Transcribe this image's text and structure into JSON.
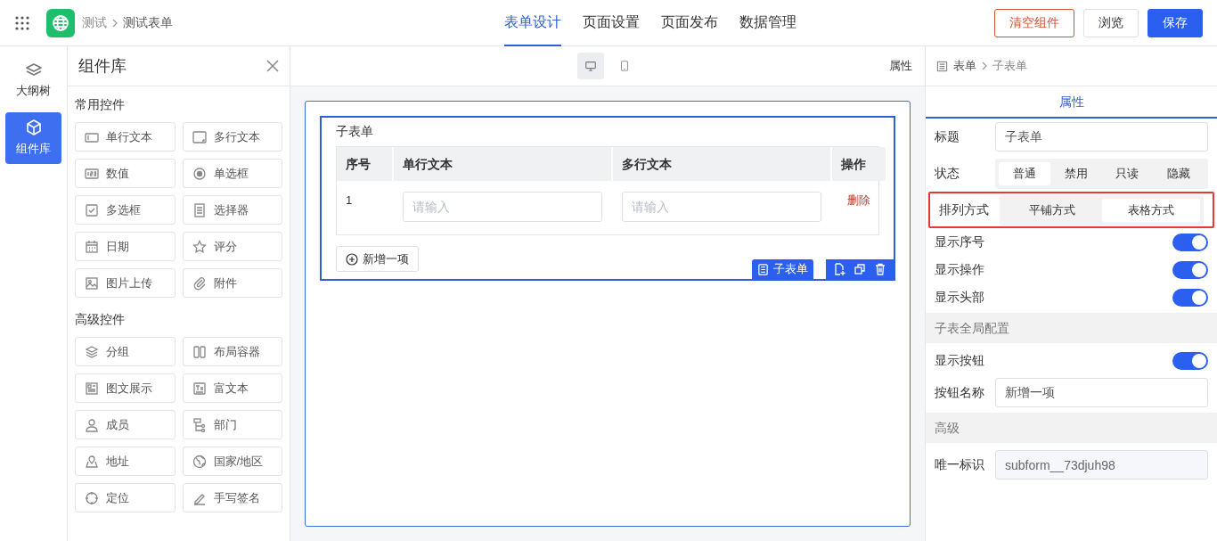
{
  "header": {
    "breadcrumb": [
      "测试",
      "测试表单"
    ],
    "tabs": [
      {
        "label": "表单设计",
        "selected": true
      },
      {
        "label": "页面设置",
        "selected": false
      },
      {
        "label": "页面发布",
        "selected": false
      },
      {
        "label": "数据管理",
        "selected": false
      }
    ],
    "buttons": [
      {
        "label": "清空组件",
        "kind": "danger"
      },
      {
        "label": "浏览",
        "kind": "default"
      },
      {
        "label": "保存",
        "kind": "primary"
      }
    ]
  },
  "rail": [
    {
      "label": "大纲树",
      "selected": false
    },
    {
      "label": "组件库",
      "selected": true
    }
  ],
  "library": {
    "title": "组件库",
    "sections": [
      {
        "title": "常用控件",
        "items": [
          "单行文本",
          "多行文本",
          "数值",
          "单选框",
          "多选框",
          "选择器",
          "日期",
          "评分",
          "图片上传",
          "附件"
        ]
      },
      {
        "title": "高级控件",
        "items": [
          "分组",
          "布局容器",
          "图文展示",
          "富文本",
          "成员",
          "部门",
          "地址",
          "国家/地区",
          "定位",
          "手写签名"
        ]
      }
    ]
  },
  "canvas": {
    "devices": [
      {
        "selected": true
      },
      {
        "selected": false
      }
    ],
    "panel_label": "属性",
    "subform": {
      "title": "子表单",
      "columns": [
        "序号",
        "单行文本",
        "多行文本",
        "操作"
      ],
      "rows": [
        {
          "index": "1",
          "placeholders": [
            "请输入",
            "请输入"
          ],
          "action": "删除"
        }
      ],
      "add_button": "新增一项",
      "tag": "子表单"
    }
  },
  "properties": {
    "breadcrumb": [
      "表单",
      "子表单"
    ],
    "tab": {
      "label": "属性",
      "selected": true
    },
    "rows": [
      {
        "kind": "input",
        "label": "标题",
        "value": "子表单"
      },
      {
        "kind": "segmented",
        "label": "状态",
        "options": [
          {
            "label": "普通",
            "selected": true
          },
          {
            "label": "禁用",
            "selected": false
          },
          {
            "label": "只读",
            "selected": false
          },
          {
            "label": "隐藏",
            "selected": false
          }
        ]
      },
      {
        "kind": "segmented",
        "label": "排列方式",
        "highlighted": true,
        "options": [
          {
            "label": "平铺方式",
            "selected": false
          },
          {
            "label": "表格方式",
            "selected": true
          }
        ]
      },
      {
        "kind": "toggle",
        "label": "显示序号",
        "on": true
      },
      {
        "kind": "toggle",
        "label": "显示操作",
        "on": true
      },
      {
        "kind": "toggle",
        "label": "显示头部",
        "on": true
      },
      {
        "kind": "section",
        "label": "子表全局配置"
      },
      {
        "kind": "toggle",
        "label": "显示按钮",
        "on": true
      },
      {
        "kind": "input",
        "label": "按钮名称",
        "value": "新增一项"
      },
      {
        "kind": "section",
        "label": "高级"
      },
      {
        "kind": "readonly",
        "label": "唯一标识",
        "value": "subform__73djuh98"
      }
    ]
  }
}
